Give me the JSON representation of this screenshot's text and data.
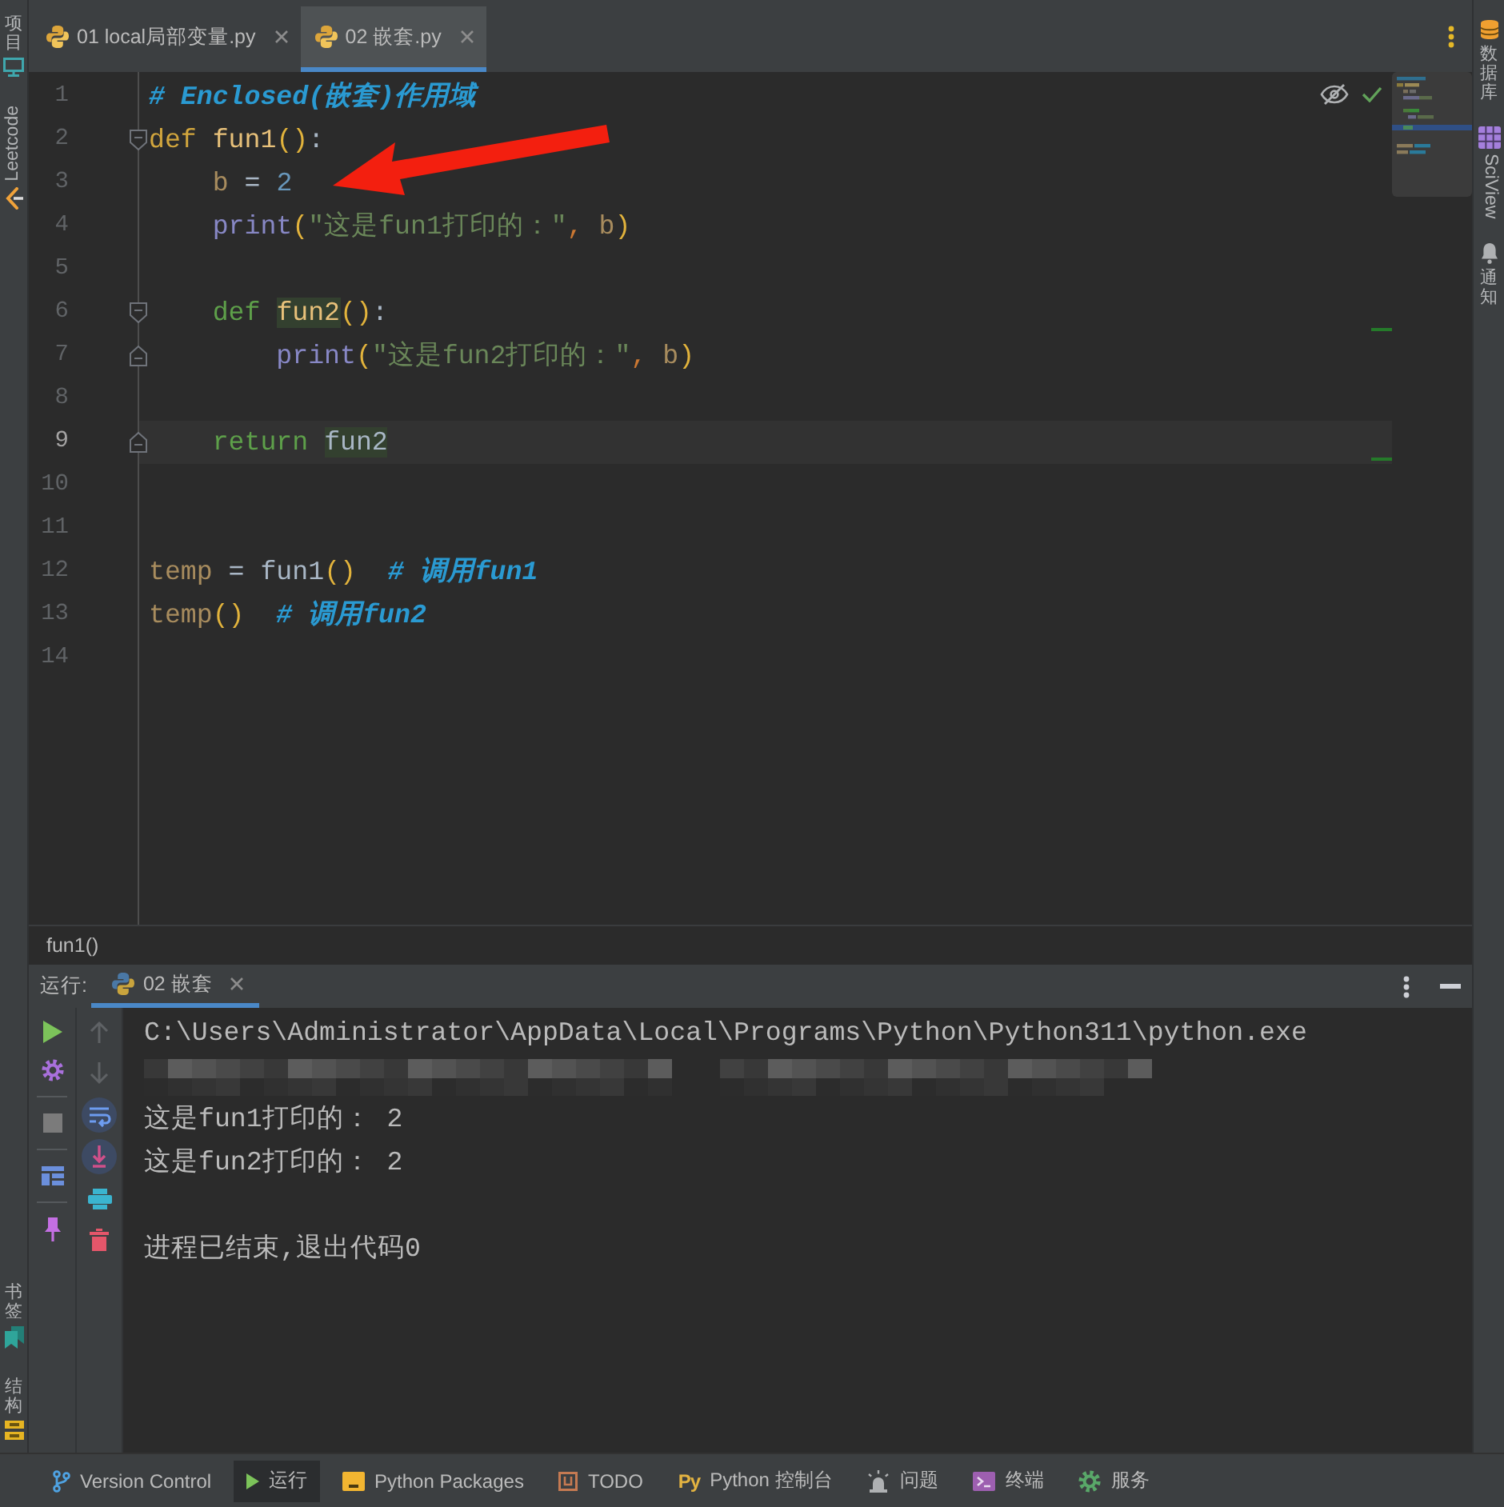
{
  "tool_strip_left": {
    "top": [
      {
        "label": "项目",
        "kind": "stacked"
      },
      {
        "label": "Leetcode",
        "kind": "rotated"
      }
    ],
    "bottom": [
      {
        "label": "书签",
        "kind": "stacked"
      },
      {
        "label": "结构",
        "kind": "stacked"
      }
    ]
  },
  "tabs": [
    {
      "label": "01 local局部变量.py",
      "selected": false
    },
    {
      "label": "02 嵌套.py",
      "selected": true
    }
  ],
  "editor": {
    "lines": [
      {
        "number": "1",
        "current": false,
        "kind": "plain",
        "tokens": [
          {
            "text": "# Enclosed(嵌套)作用域",
            "kind": "comment",
            "highlighted": false
          }
        ]
      },
      {
        "number": "2",
        "current": false,
        "kind": "fold_start",
        "tokens": [
          {
            "text": "def ",
            "kind": "declaration",
            "highlighted": false
          },
          {
            "text": "fun1",
            "kind": "function",
            "highlighted": false
          },
          {
            "text": "()",
            "kind": "paren",
            "highlighted": false
          },
          {
            "text": ":",
            "kind": "plain",
            "highlighted": false
          }
        ]
      },
      {
        "number": "3",
        "current": false,
        "kind": "plain",
        "tokens": [
          {
            "text": "    b",
            "kind": "variable",
            "highlighted": false
          },
          {
            "text": " = ",
            "kind": "plain",
            "highlighted": false
          },
          {
            "text": "2",
            "kind": "number",
            "highlighted": false
          }
        ]
      },
      {
        "number": "4",
        "current": false,
        "kind": "plain",
        "tokens": [
          {
            "text": "    print",
            "kind": "builtin",
            "highlighted": false
          },
          {
            "text": "(",
            "kind": "paren",
            "highlighted": false
          },
          {
            "text": "\"这是fun1打印的：\"",
            "kind": "string",
            "highlighted": false
          },
          {
            "text": ", ",
            "kind": "punctuation",
            "highlighted": false
          },
          {
            "text": "b",
            "kind": "variable",
            "highlighted": false
          },
          {
            "text": ")",
            "kind": "paren",
            "highlighted": false
          }
        ]
      },
      {
        "number": "5",
        "current": false,
        "kind": "plain"
      },
      {
        "number": "6",
        "current": false,
        "kind": "fold_start",
        "tokens": [
          {
            "text": "    def ",
            "kind": "keyword",
            "highlighted": false
          },
          {
            "text": "fun2",
            "kind": "function",
            "highlighted": true
          },
          {
            "text": "()",
            "kind": "paren",
            "highlighted": false
          },
          {
            "text": ":",
            "kind": "plain",
            "highlighted": false
          }
        ]
      },
      {
        "number": "7",
        "current": false,
        "kind": "fold_end",
        "tokens": [
          {
            "text": "        print",
            "kind": "builtin",
            "highlighted": false
          },
          {
            "text": "(",
            "kind": "paren",
            "highlighted": false
          },
          {
            "text": "\"这是fun2打印的：\"",
            "kind": "string",
            "highlighted": false
          },
          {
            "text": ", ",
            "kind": "punctuation",
            "highlighted": false
          },
          {
            "text": "b",
            "kind": "variable",
            "highlighted": false
          },
          {
            "text": ")",
            "kind": "paren",
            "highlighted": false
          }
        ]
      },
      {
        "number": "8",
        "current": false,
        "kind": "plain"
      },
      {
        "number": "9",
        "current": true,
        "kind": "fold_end",
        "tokens": [
          {
            "text": "    return ",
            "kind": "keyword",
            "highlighted": false
          },
          {
            "text": "fun2",
            "kind": "plain",
            "highlighted": true
          }
        ]
      },
      {
        "number": "10",
        "current": false,
        "kind": "plain"
      },
      {
        "number": "11",
        "current": false,
        "kind": "plain"
      },
      {
        "number": "12",
        "current": false,
        "kind": "plain",
        "tokens": [
          {
            "text": "temp",
            "kind": "variable",
            "highlighted": false
          },
          {
            "text": " = ",
            "kind": "plain",
            "highlighted": false
          },
          {
            "text": "fun1",
            "kind": "plain",
            "highlighted": false
          },
          {
            "text": "()",
            "kind": "paren",
            "highlighted": false
          },
          {
            "text": "  # 调用fun1",
            "kind": "comment",
            "highlighted": false
          }
        ]
      },
      {
        "number": "13",
        "current": false,
        "kind": "plain",
        "tokens": [
          {
            "text": "temp",
            "kind": "variable",
            "highlighted": false
          },
          {
            "text": "()",
            "kind": "paren",
            "highlighted": false
          },
          {
            "text": "  # 调用fun2",
            "kind": "comment",
            "highlighted": false
          }
        ]
      },
      {
        "number": "14",
        "current": false,
        "kind": "plain"
      }
    ]
  },
  "breadcrumb": "fun1()",
  "run_panel": {
    "label": "运行:",
    "tabs": [
      {
        "label": "02 嵌套",
        "selected": true
      }
    ],
    "toolbar": {
      "main": [
        [
          {
            "disabled": false
          },
          {
            "disabled": false
          }
        ],
        [
          {
            "disabled": true
          }
        ],
        [
          {
            "disabled": false
          }
        ],
        [
          {
            "disabled": false
          }
        ]
      ],
      "side": [
        {
          "disabled": true
        },
        {
          "disabled": true
        },
        {
          "disabled": false,
          "on": true
        },
        {
          "disabled": false,
          "on": true
        },
        {
          "disabled": false
        },
        {
          "disabled": false
        }
      ]
    },
    "console": [
      {
        "kind": "command",
        "text": "C:\\Users\\Administrator\\AppData\\Local\\Programs\\Python\\Python311\\python.exe"
      },
      {
        "kind": "redacted"
      },
      {
        "kind": "output",
        "text": "这是fun1打印的： 2"
      },
      {
        "kind": "output",
        "text": "这是fun2打印的： 2"
      },
      {
        "kind": "blank"
      },
      {
        "kind": "output",
        "text": "进程已结束,退出代码0"
      }
    ]
  },
  "tool_strip_right": [
    {
      "label": "数据库",
      "kind": "stacked"
    },
    {
      "label": "SciView",
      "kind": "rotated"
    },
    {
      "label": "通知",
      "kind": "stacked"
    }
  ],
  "status_bar": [
    {
      "label": "Version Control",
      "selected": false
    },
    {
      "label": "运行",
      "selected": true
    },
    {
      "label": "Python Packages",
      "selected": false
    },
    {
      "label": "TODO",
      "selected": false
    },
    {
      "label": "Python 控制台",
      "selected": false,
      "glyph": "Py"
    },
    {
      "label": "问题",
      "selected": false
    },
    {
      "label": "终端",
      "selected": false
    },
    {
      "label": "服务",
      "selected": false
    }
  ]
}
